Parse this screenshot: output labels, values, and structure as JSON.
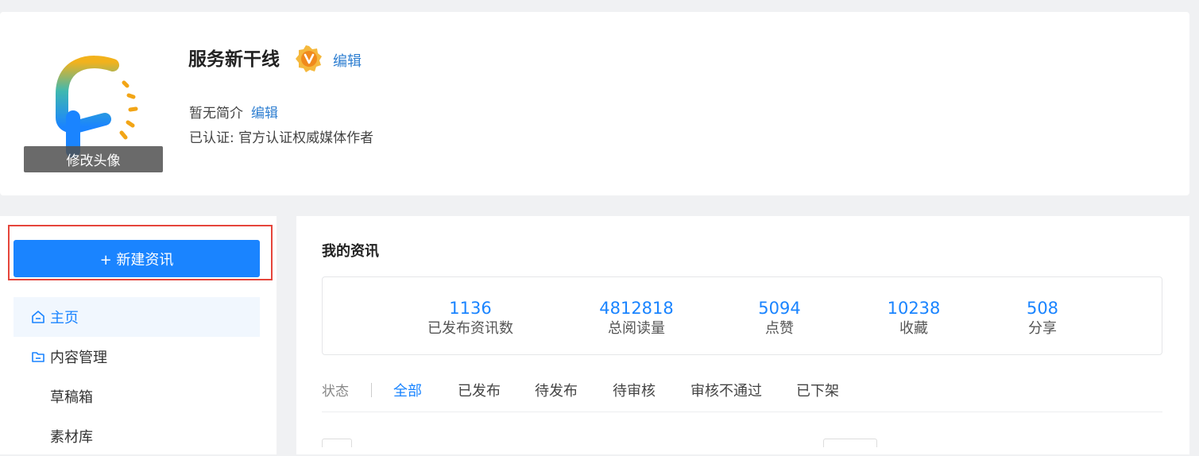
{
  "profile": {
    "name": "服务新干线",
    "name_edit": "编辑",
    "intro": "暂无简介",
    "intro_edit": "编辑",
    "certification": "已认证: 官方认证权威媒体作者",
    "avatar_overlay": "修改头像",
    "badge_icon": "verified-v-badge-icon",
    "colors": {
      "badge": "#f5a623",
      "link": "#2f7fd1"
    }
  },
  "sidebar": {
    "new_button_label": "+ 新建资讯",
    "items": [
      {
        "label": "主页",
        "icon": "home-icon",
        "active": true
      },
      {
        "label": "内容管理",
        "icon": "folder-icon",
        "active": false
      },
      {
        "label": "草稿箱",
        "active": false
      },
      {
        "label": "素材库",
        "active": false
      }
    ]
  },
  "main": {
    "title": "我的资讯",
    "stats": [
      {
        "value": "1136",
        "label": "已发布资讯数"
      },
      {
        "value": "4812818",
        "label": "总阅读量"
      },
      {
        "value": "5094",
        "label": "点赞"
      },
      {
        "value": "10238",
        "label": "收藏"
      },
      {
        "value": "508",
        "label": "分享"
      }
    ],
    "status_label": "状态",
    "status_tabs": [
      {
        "label": "全部",
        "active": true
      },
      {
        "label": "已发布",
        "active": false
      },
      {
        "label": "待发布",
        "active": false
      },
      {
        "label": "待审核",
        "active": false
      },
      {
        "label": "审核不通过",
        "active": false
      },
      {
        "label": "已下架",
        "active": false
      }
    ]
  },
  "colors": {
    "accent": "#1a84ff",
    "highlight": "#e5453b",
    "background": "#f0f1f3"
  }
}
